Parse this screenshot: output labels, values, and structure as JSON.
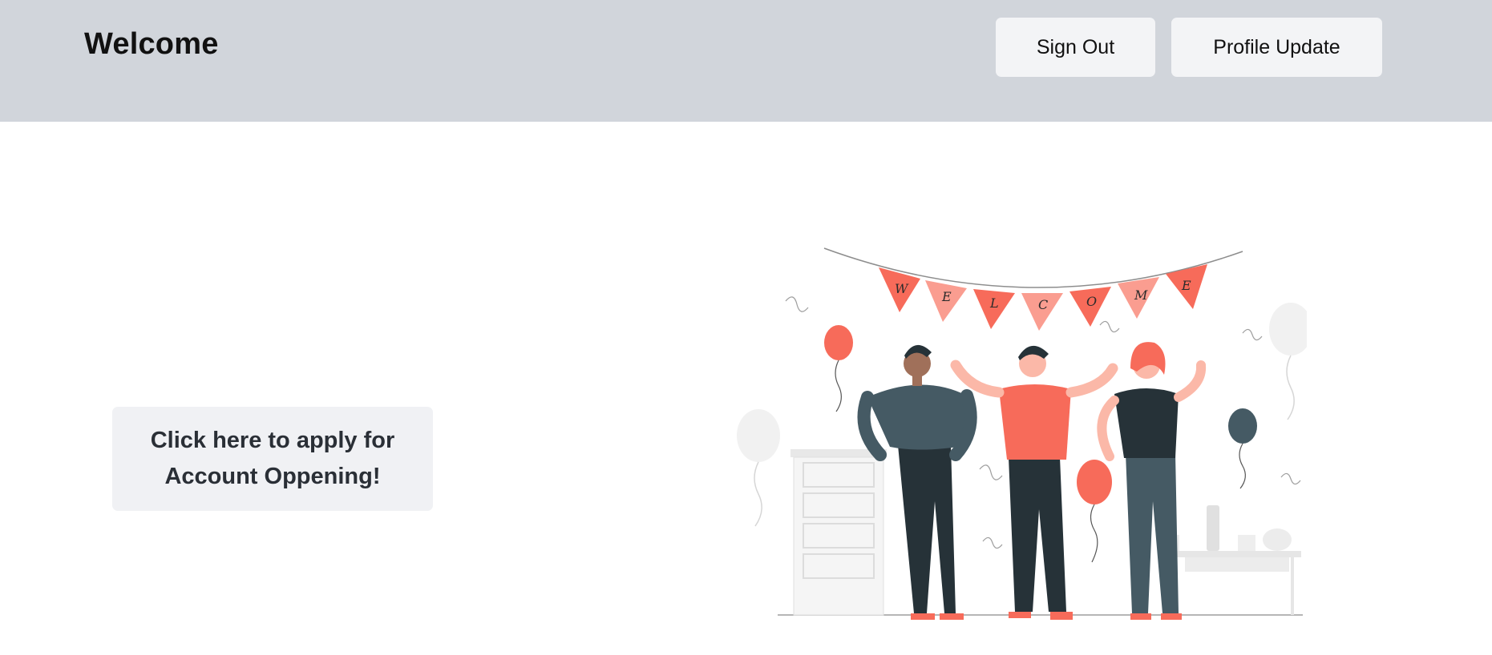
{
  "header": {
    "title": "Welcome",
    "sign_out_label": "Sign Out",
    "profile_update_label": "Profile Update"
  },
  "main": {
    "apply_line1": "Click here to apply for",
    "apply_line2": "Account Oppening!",
    "illustration": {
      "banner_letters": [
        "W",
        "E",
        "L",
        "C",
        "O",
        "M",
        "E"
      ]
    }
  },
  "colors": {
    "header_bg": "#d1d5db",
    "button_bg": "#f3f4f6",
    "accent": "#f76b5a",
    "accent_light": "#fa9d90",
    "dark": "#263238",
    "slate": "#455a64"
  }
}
